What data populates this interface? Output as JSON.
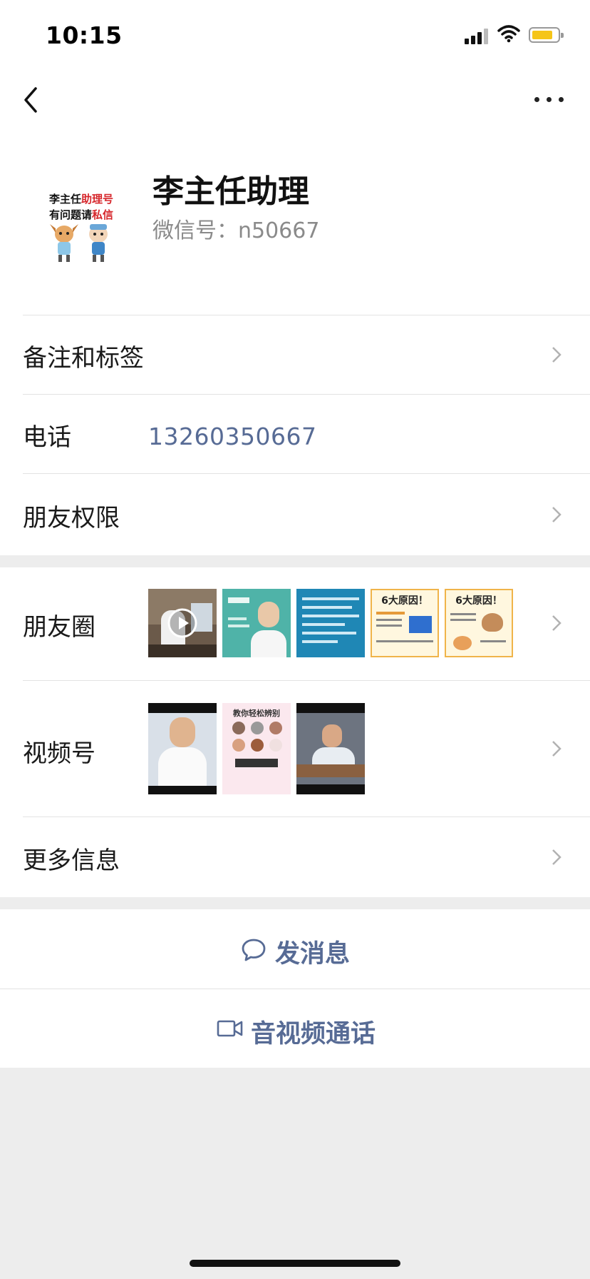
{
  "status_bar": {
    "time": "10:15"
  },
  "profile": {
    "name": "李主任助理",
    "wechat_id": "微信号：n50667",
    "avatar_text": {
      "line1_a": "李主任",
      "line1_b": "助理号",
      "line2_a": "有问题请",
      "line2_b": "私信"
    }
  },
  "rows": {
    "notes_tags": "备注和标签",
    "phone_label": "电话",
    "phone_value": "13260350667",
    "friend_permissions": "朋友权限",
    "moments": "朋友圈",
    "channels": "视频号",
    "more_info": "更多信息"
  },
  "moments_thumbs": {
    "t4_title": "6大原因！",
    "t5_title": "6大原因！"
  },
  "channels_thumbs": {
    "v2_title": "教你轻松辨别"
  },
  "actions": {
    "send_message": "发消息",
    "av_call": "音视频通话"
  },
  "icons": {
    "back": "back-chevron-icon",
    "more": "more-dots-icon",
    "chevron": "chevron-right-icon",
    "message": "message-bubble-icon",
    "video": "video-camera-icon"
  },
  "colors": {
    "link": "#576b95",
    "battery": "#f5c518",
    "background": "#ededed"
  }
}
